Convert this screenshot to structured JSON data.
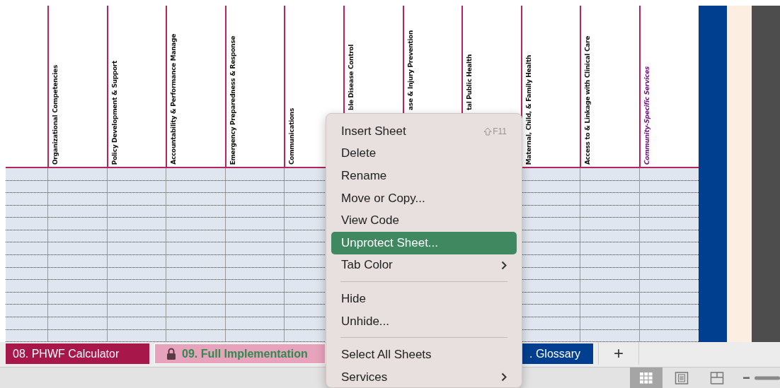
{
  "columns": [
    {
      "label": "Organizational Competencies",
      "kind": "standard"
    },
    {
      "label": "Policy Development & Support",
      "kind": "standard"
    },
    {
      "label": "Accountability & Performance Manage",
      "kind": "standard"
    },
    {
      "label": "Emergency Preparedness & Response",
      "kind": "standard"
    },
    {
      "label": "Communications",
      "kind": "standard"
    },
    {
      "label": "ble Disease Control",
      "kind": "standard"
    },
    {
      "label": "ase & Injury Prevention",
      "kind": "standard"
    },
    {
      "label": "tal Public Health",
      "kind": "standard"
    },
    {
      "label": "Maternal, Child, & Family Health",
      "kind": "standard"
    },
    {
      "label": "Access to & Linkage with Clinical Care",
      "kind": "standard"
    },
    {
      "label": "Community-Specific Services",
      "kind": "custom"
    }
  ],
  "sheet_tabs": [
    {
      "label": "08. PHWF Calculator",
      "selected": false,
      "locked": false,
      "color": "#a8174a"
    },
    {
      "label": "09. Full Implementation",
      "selected": true,
      "locked": true,
      "color": "#e8a3bc"
    },
    {
      "label": ". Glossary",
      "selected": false,
      "locked": false,
      "color": "#003f8f"
    }
  ],
  "add_sheet": "+",
  "context_menu": [
    {
      "kind": "item",
      "label": "Insert Sheet",
      "shortcut": "F11",
      "highlighted": false,
      "submenu": false
    },
    {
      "kind": "item",
      "label": "Delete",
      "highlighted": false,
      "submenu": false
    },
    {
      "kind": "item",
      "label": "Rename",
      "highlighted": false,
      "submenu": false
    },
    {
      "kind": "item",
      "label": "Move or Copy...",
      "highlighted": false,
      "submenu": false
    },
    {
      "kind": "item",
      "label": "View Code",
      "highlighted": false,
      "submenu": false
    },
    {
      "kind": "item",
      "label": "Unprotect Sheet...",
      "highlighted": true,
      "submenu": false
    },
    {
      "kind": "item",
      "label": "Tab Color",
      "highlighted": false,
      "submenu": true
    },
    {
      "kind": "separator"
    },
    {
      "kind": "item",
      "label": "Hide",
      "highlighted": false,
      "submenu": false
    },
    {
      "kind": "item",
      "label": "Unhide...",
      "highlighted": false,
      "submenu": false
    },
    {
      "kind": "separator"
    },
    {
      "kind": "item",
      "label": "Select All Sheets",
      "highlighted": false,
      "submenu": false
    },
    {
      "kind": "item",
      "label": "Services",
      "highlighted": false,
      "submenu": true
    }
  ],
  "status_bar": {
    "views": [
      {
        "kind": "normal",
        "selected": true
      },
      {
        "kind": "page_layout",
        "selected": false
      },
      {
        "kind": "page_break",
        "selected": false
      }
    ]
  }
}
